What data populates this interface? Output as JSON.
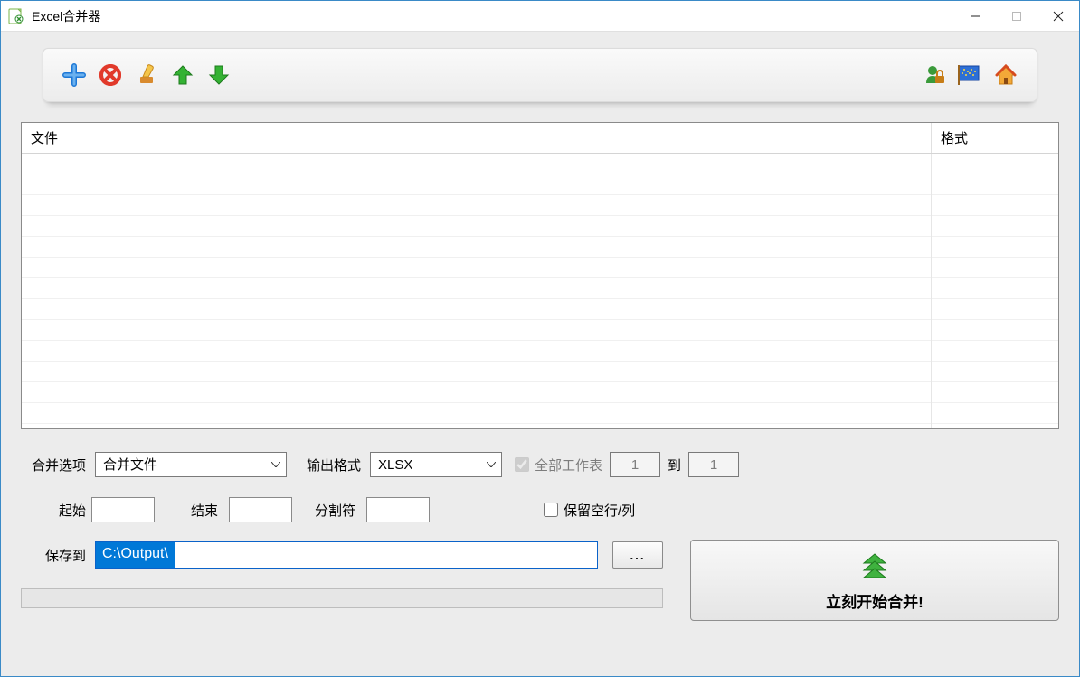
{
  "window": {
    "title": "Excel合并器"
  },
  "grid": {
    "headers": {
      "file": "文件",
      "format": "格式"
    }
  },
  "labels": {
    "mergeOption": "合并选项",
    "outputFormat": "输出格式",
    "allSheets": "全部工作表",
    "to": "到",
    "start": "起始",
    "end": "结束",
    "delimiter": "分割符",
    "keepBlank": "保留空行/列",
    "saveTo": "保存到"
  },
  "values": {
    "mergeOption": "合并文件",
    "outputFormat": "XLSX",
    "sheetsFrom": "1",
    "sheetsTo": "1",
    "start": "",
    "end": "",
    "delimiter": "",
    "savePath": "C:\\Output\\"
  },
  "buttons": {
    "browse": "...",
    "merge": "立刻开始合并!"
  },
  "toolbarIcons": {
    "add": "add-icon",
    "remove": "remove-icon",
    "clear": "clear-icon",
    "up": "up-icon",
    "down": "down-icon",
    "reg": "register-icon",
    "lang": "language-icon",
    "home": "home-icon"
  }
}
